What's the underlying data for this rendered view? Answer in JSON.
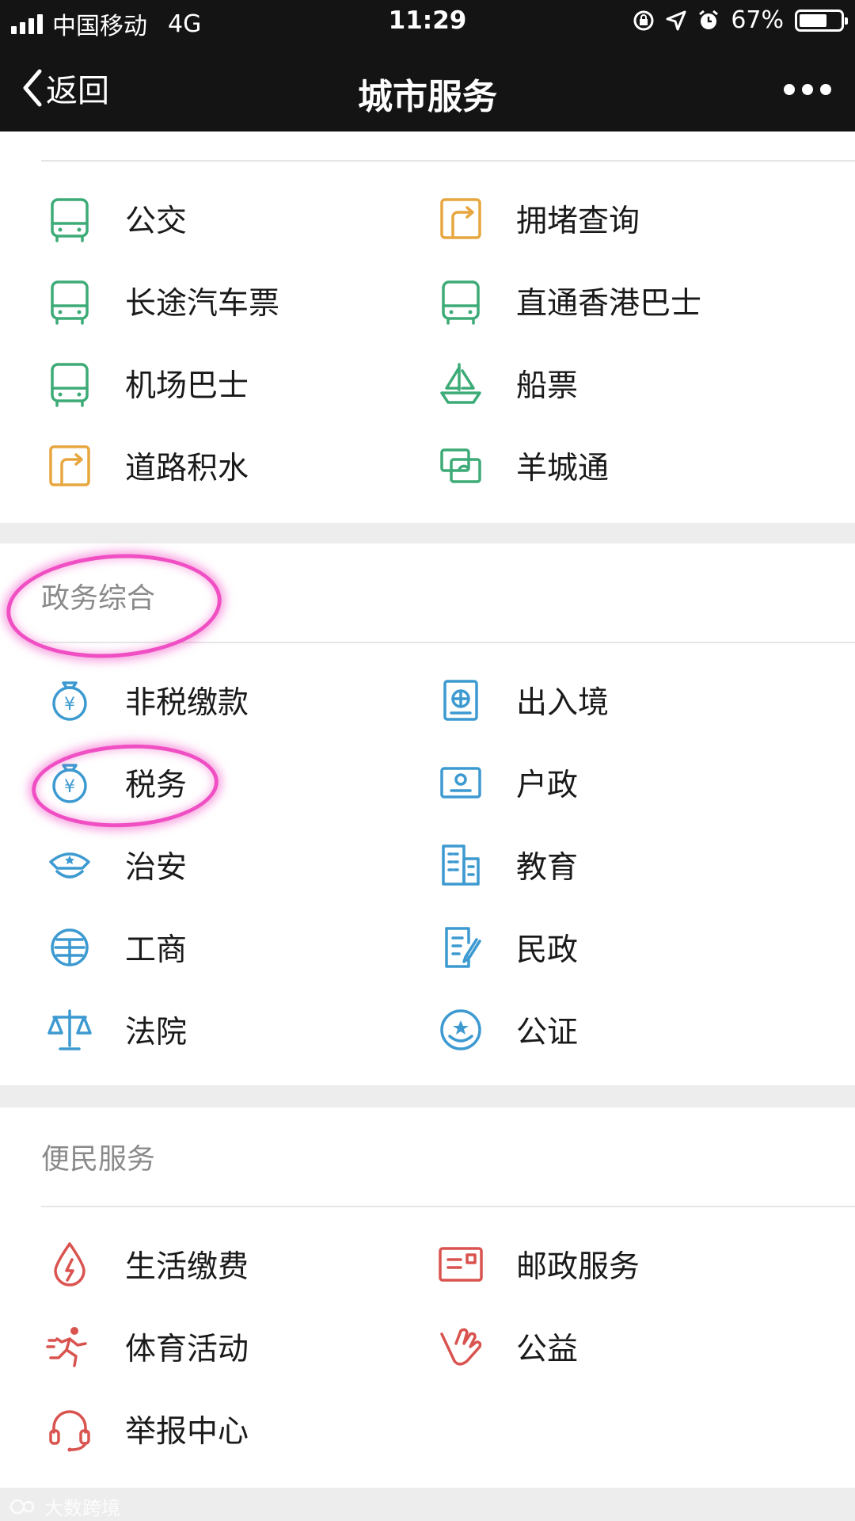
{
  "status_bar": {
    "carrier": "中国移动",
    "network": "4G",
    "time": "11:29",
    "battery_percent": "67%",
    "battery_level": 0.67
  },
  "nav": {
    "back_label": "返回",
    "title": "城市服务"
  },
  "colors": {
    "traffic_green": "#3dab77",
    "traffic_orange": "#e7a63f",
    "gov_blue": "#3d9ad1",
    "life_red": "#d9534f",
    "highlight": "#f04fc4"
  },
  "transport": {
    "items": [
      {
        "label": "公交",
        "icon": "bus-icon"
      },
      {
        "label": "拥堵查询",
        "icon": "road-sign-icon"
      },
      {
        "label": "长途汽车票",
        "icon": "bus-icon"
      },
      {
        "label": "直通香港巴士",
        "icon": "bus-icon"
      },
      {
        "label": "机场巴士",
        "icon": "bus-icon"
      },
      {
        "label": "船票",
        "icon": "ship-icon"
      },
      {
        "label": "道路积水",
        "icon": "road-sign-icon"
      },
      {
        "label": "羊城通",
        "icon": "transit-card-icon"
      }
    ]
  },
  "government": {
    "title": "政务综合",
    "items": [
      {
        "label": "非税缴款",
        "icon": "money-bag-icon"
      },
      {
        "label": "出入境",
        "icon": "passport-icon"
      },
      {
        "label": "税务",
        "icon": "money-bag-icon"
      },
      {
        "label": "户政",
        "icon": "id-card-icon"
      },
      {
        "label": "治安",
        "icon": "police-cap-icon"
      },
      {
        "label": "教育",
        "icon": "school-building-icon"
      },
      {
        "label": "工商",
        "icon": "commerce-icon"
      },
      {
        "label": "民政",
        "icon": "document-icon"
      },
      {
        "label": "法院",
        "icon": "scales-icon"
      },
      {
        "label": "公证",
        "icon": "seal-icon"
      }
    ]
  },
  "convenience": {
    "title": "便民服务",
    "items": [
      {
        "label": "生活缴费",
        "icon": "utility-drop-icon"
      },
      {
        "label": "邮政服务",
        "icon": "envelope-icon"
      },
      {
        "label": "体育活动",
        "icon": "runner-icon"
      },
      {
        "label": "公益",
        "icon": "helping-hand-icon"
      },
      {
        "label": "举报中心",
        "icon": "headset-icon"
      }
    ]
  },
  "watermark": "大数跨境"
}
